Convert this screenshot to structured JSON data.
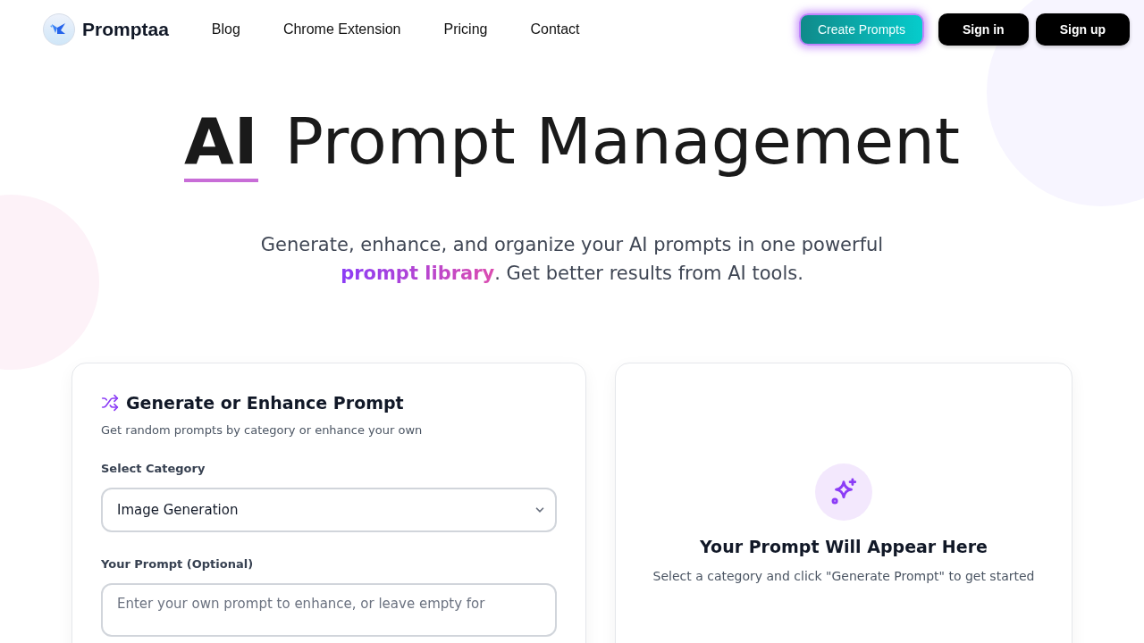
{
  "header": {
    "brand": "Promptaa",
    "nav": [
      {
        "label": "Blog"
      },
      {
        "label": "Chrome Extension"
      },
      {
        "label": "Pricing"
      },
      {
        "label": "Contact"
      }
    ],
    "buttons": [
      {
        "label": "Create Prompts",
        "kind": "glow"
      },
      {
        "label": "Sign in",
        "kind": "dark"
      },
      {
        "label": "Sign up",
        "kind": "dark"
      }
    ]
  },
  "hero": {
    "title_strong": "AI",
    "title_rest": "Prompt Management",
    "subtitle": "Generate, enhance, and organize your AI prompts in one powerful **prompt library**. Get better results from AI tools."
  },
  "generator": {
    "title": "Generate or Enhance Prompt",
    "description": "Get random prompts by category or enhance your own",
    "category_label": "Select Category",
    "category_value": "Image Generation",
    "prompt_label": "Your Prompt (Optional)",
    "prompt_placeholder": "Enter your own prompt to enhance, or leave empty for"
  },
  "output": {
    "title": "Your Prompt Will Appear Here",
    "hint": "Select a category and click \"Generate Prompt\" to get started"
  }
}
